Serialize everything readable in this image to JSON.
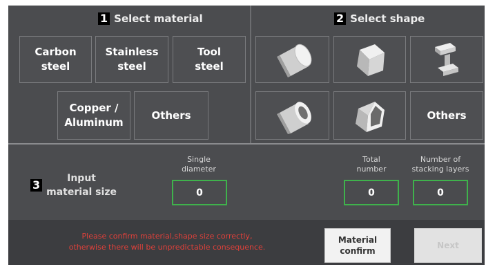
{
  "material_section": {
    "step": "1",
    "title": "Select material",
    "options": [
      "Carbon\nsteel",
      "Stainless\nsteel",
      "Tool\nsteel",
      "Copper /\nAluminum",
      "Others"
    ]
  },
  "shape_section": {
    "step": "2",
    "title": "Select shape",
    "shapes": [
      "solid-cylinder-icon",
      "solid-cube-icon",
      "i-beam-icon",
      "hollow-tube-icon",
      "hollow-square-tube-icon"
    ],
    "others_label": "Others"
  },
  "size_section": {
    "step": "3",
    "title": "Input\nmaterial size",
    "single_diameter": {
      "label": "Single\ndiameter",
      "value": "0"
    },
    "total_number": {
      "label": "Total\nnumber",
      "value": "0"
    },
    "stacking_layers": {
      "label": "Number of\nstacking layers",
      "value": "0"
    }
  },
  "footer": {
    "warning": "Please confirm material,shape size correctly,\notherwise there will be unpredictable consequence.",
    "confirm_label": "Material\nconfirm",
    "next_label": "Next"
  },
  "colors": {
    "panel": "#4b4c4f",
    "input_border": "#3fb24c",
    "warning_text": "#e0403a"
  }
}
